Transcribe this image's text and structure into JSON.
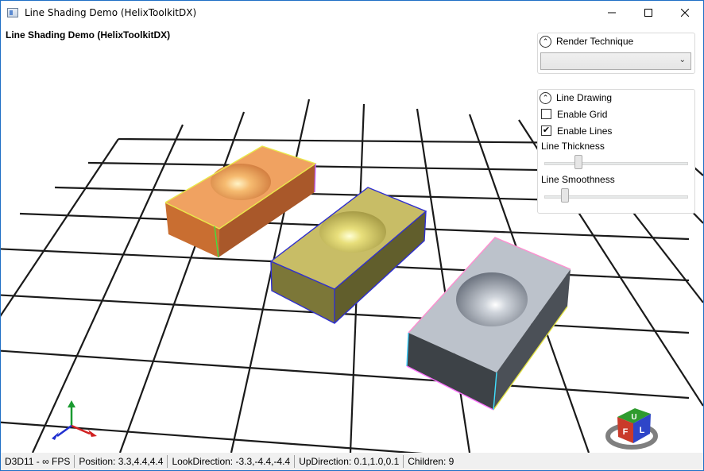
{
  "window": {
    "title": "Line Shading Demo (HelixToolkitDX)",
    "controls": {
      "minimize_icon": "minimize-icon",
      "maximize_icon": "maximize-icon",
      "close_icon": "close-icon"
    }
  },
  "viewport": {
    "overlay_title": "Line Shading Demo (HelixToolkitDX)",
    "objects": [
      {
        "name": "box-orange",
        "color": "#d8844a"
      },
      {
        "name": "box-yellow",
        "color": "#b9ad5a"
      },
      {
        "name": "box-gray",
        "color": "#b8bec7"
      }
    ],
    "view_cube": {
      "faces": [
        "U",
        "F",
        "L"
      ]
    }
  },
  "render_panel": {
    "title": "Render Technique",
    "combo_value": ""
  },
  "line_panel": {
    "title": "Line Drawing",
    "enable_grid_label": "Enable Grid",
    "enable_grid_checked": false,
    "enable_lines_label": "Enable Lines",
    "enable_lines_checked": true,
    "thickness_label": "Line Thickness",
    "thickness_value": 0.22,
    "smoothness_label": "Line Smoothness",
    "smoothness_value": 0.12
  },
  "status": {
    "fps": "D3D11 - ∞ FPS",
    "position": "Position: 3.3,4.4,4.4",
    "look_direction": "LookDirection: -3.3,-4.4,-4.4",
    "up_direction": "UpDirection: 0.1,1.0,0.1",
    "children": "Children: 9"
  }
}
